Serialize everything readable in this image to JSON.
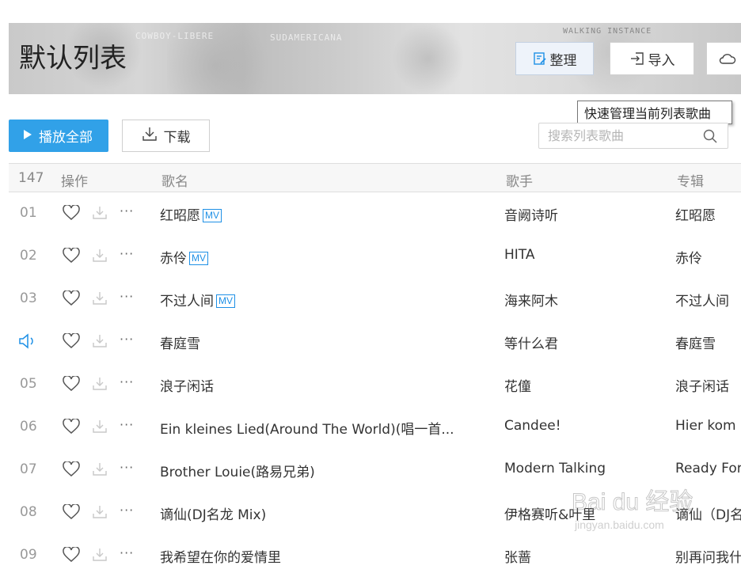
{
  "page": {
    "title": "默认列表",
    "banner_text": [
      "COWBOY-LIBERE",
      "SUDAMERICANA",
      "WALKING INSTANCE"
    ]
  },
  "header_buttons": {
    "organize": "整理",
    "import": "导入"
  },
  "tooltip": "快速管理当前列表歌曲",
  "toolbar": {
    "play_all": "播放全部",
    "download": "下载",
    "search_placeholder": "搜索列表歌曲"
  },
  "table": {
    "count": "147",
    "columns": {
      "ops": "操作",
      "name": "歌名",
      "artist": "歌手",
      "album": "专辑"
    },
    "rows": [
      {
        "index": "01",
        "name": "红昭愿",
        "mv": "MV",
        "artist": "音阙诗听",
        "album": "红昭愿"
      },
      {
        "index": "02",
        "name": "赤伶",
        "mv": "MV",
        "artist": "HITA",
        "album": "赤伶"
      },
      {
        "index": "03",
        "name": "不过人间",
        "mv": "MV",
        "artist": "海来阿木",
        "album": "不过人间"
      },
      {
        "index": "",
        "name": "春庭雪",
        "mv": "",
        "artist": "等什么君",
        "album": "春庭雪",
        "playing": true
      },
      {
        "index": "05",
        "name": "浪子闲话",
        "mv": "",
        "artist": "花僮",
        "album": "浪子闲话"
      },
      {
        "index": "06",
        "name": "Ein kleines Lied(Around The World)(唱一首...",
        "mv": "",
        "artist": "Candee!",
        "album": "Hier kom"
      },
      {
        "index": "07",
        "name": "Brother Louie(路易兄弟)",
        "mv": "",
        "artist": "Modern Talking",
        "album": "Ready For"
      },
      {
        "index": "08",
        "name": "谪仙(DJ名龙 Mix)",
        "mv": "",
        "artist": "伊格赛听&叶里",
        "album": "谪仙（DJ名"
      },
      {
        "index": "09",
        "name": "我希望在你的爱情里",
        "mv": "",
        "artist": "张蔷",
        "album": "别再问我什"
      }
    ]
  },
  "watermark": {
    "brand": "Bai du 经验",
    "url": "jingyan.baidu.com"
  },
  "colors": {
    "accent": "#31a1e8",
    "mv": "#1e90e6"
  }
}
